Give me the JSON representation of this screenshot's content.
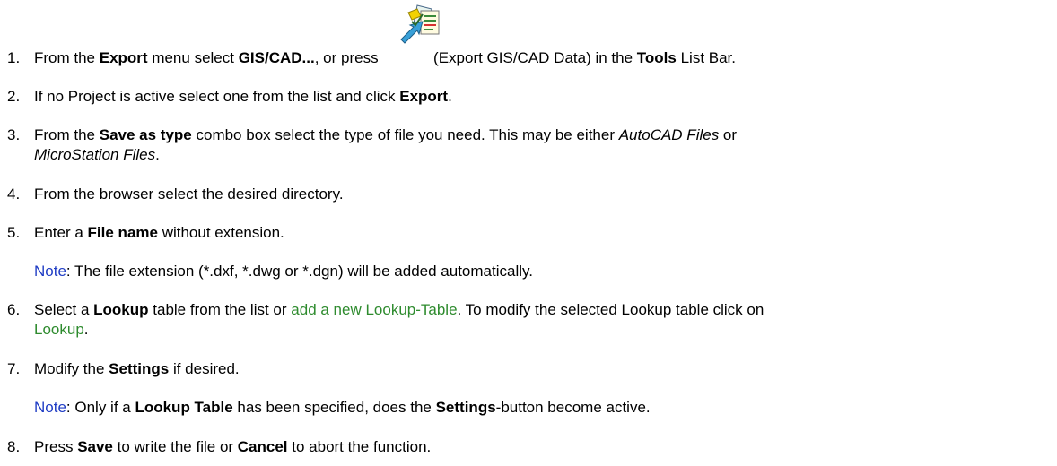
{
  "steps": {
    "s1": {
      "num": "1.",
      "a": "From the ",
      "b": "Export",
      "c": " menu select ",
      "d": "GIS/CAD...",
      "e": ", or press ",
      "f": " (Export GIS/CAD Data) in the ",
      "g": "Tools",
      "h": " List Bar."
    },
    "s2": {
      "num": "2.",
      "a": "If no Project is active select one from the list and click ",
      "b": "Export",
      "c": "."
    },
    "s3": {
      "num": "3.",
      "a": "From the ",
      "b": "Save as type",
      "c": " combo box select the type of file you need. This may be either ",
      "d": "AutoCAD Files",
      "e": " or ",
      "f": "MicroStation Files",
      "g": "."
    },
    "s4": {
      "num": "4.",
      "a": "From the browser select the desired directory."
    },
    "s5": {
      "num": "5.",
      "a": "Enter a ",
      "b": "File name",
      "c": " without extension."
    },
    "n1": {
      "label": "Note",
      "a": ": The file extension (*.dxf, *.dwg or *.dgn) will be added automatically."
    },
    "s6": {
      "num": "6.",
      "a": "Select a ",
      "b": "Lookup",
      "c": " table from the list or ",
      "link1": "add a new Lookup-Table",
      "d": ". To modify the selected Lookup table click on ",
      "link2": "Lookup",
      "e": "."
    },
    "s7": {
      "num": "7.",
      "a": "Modify the ",
      "b": "Settings",
      "c": " if desired."
    },
    "n2": {
      "label": "Note",
      "a": ": Only if a ",
      "b": "Lookup Table",
      "c": " has been specified, does the ",
      "d": "Settings",
      "e": "-button become active."
    },
    "s8": {
      "num": "8.",
      "a": "Press ",
      "b": "Save",
      "c": " to write the file or ",
      "d": "Cancel",
      "e": " to abort the function."
    }
  },
  "icons": {
    "export_gis_cad": "export-gis-cad-icon"
  },
  "colors": {
    "note": "#1f3cc4",
    "link": "#2e8b2e"
  }
}
